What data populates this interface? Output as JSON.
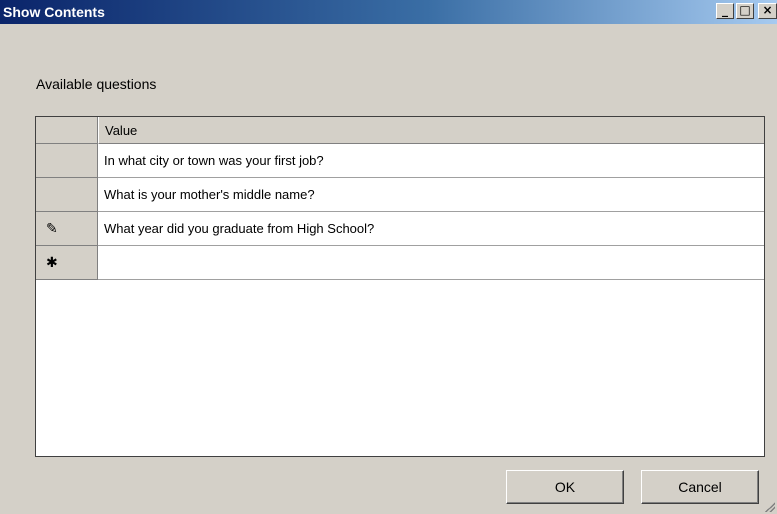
{
  "window": {
    "title": "Show Contents",
    "minimize_glyph": "_",
    "maximize_glyph": "□",
    "close_glyph": "×"
  },
  "heading": "Available questions",
  "grid": {
    "column_header": "Value",
    "rows": [
      {
        "indicator": "",
        "value": "In what city or town was your first job?"
      },
      {
        "indicator": "",
        "value": "What is your mother's middle name?"
      },
      {
        "indicator": "✎",
        "indicator_icon": "pencil-icon",
        "value": "What year did you graduate from High School?"
      },
      {
        "indicator": "✱",
        "indicator_icon": "new-row-asterisk-icon",
        "value": ""
      }
    ]
  },
  "buttons": {
    "ok_label": "OK",
    "cancel_label": "Cancel"
  },
  "colors": {
    "title_bar_start": "#0a246a",
    "title_bar_end": "#a6caf0",
    "window_background": "#d4d0c8"
  }
}
